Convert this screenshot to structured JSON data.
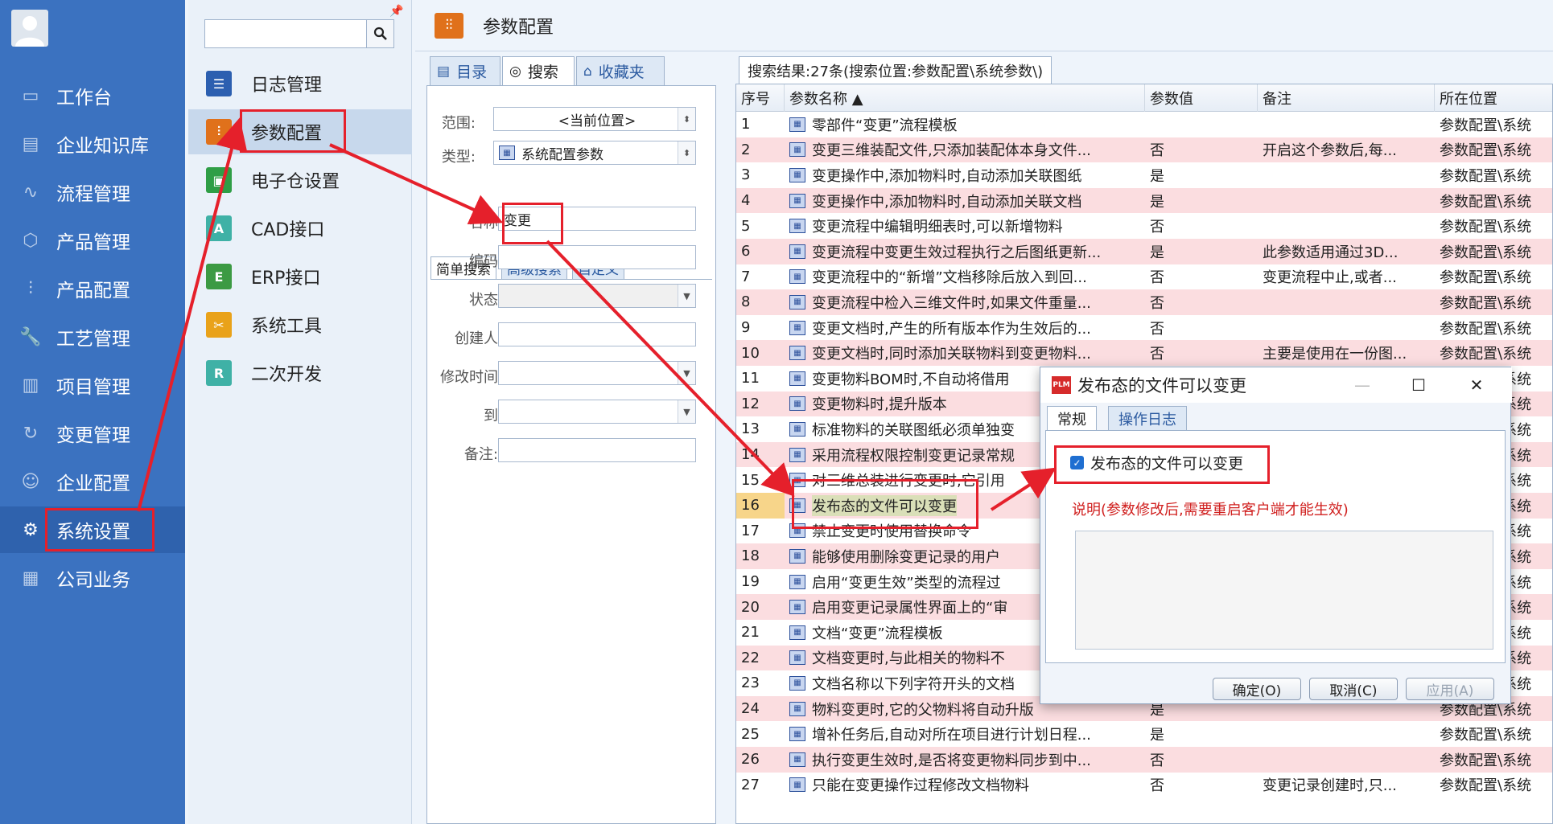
{
  "left_nav": {
    "items": [
      {
        "label": "工作台",
        "icon": "monitor-icon"
      },
      {
        "label": "企业知识库",
        "icon": "book-icon"
      },
      {
        "label": "流程管理",
        "icon": "flow-icon"
      },
      {
        "label": "产品管理",
        "icon": "cube-icon"
      },
      {
        "label": "产品配置",
        "icon": "sliders-icon"
      },
      {
        "label": "工艺管理",
        "icon": "wrench-icon"
      },
      {
        "label": "项目管理",
        "icon": "project-icon"
      },
      {
        "label": "变更管理",
        "icon": "change-icon"
      },
      {
        "label": "企业配置",
        "icon": "users-icon"
      },
      {
        "label": "系统设置",
        "icon": "gear-icon",
        "active": true
      },
      {
        "label": "公司业务",
        "icon": "grid-icon"
      }
    ]
  },
  "sub_nav": {
    "search_value": "",
    "items": [
      {
        "label": "日志管理",
        "icon": "log-icon",
        "color": "#2c5fb0"
      },
      {
        "label": "参数配置",
        "icon": "sliders-icon",
        "color": "#e0711b",
        "active": true
      },
      {
        "label": "电子仓设置",
        "icon": "warehouse-icon",
        "color": "#2f9e46"
      },
      {
        "label": "CAD接口",
        "icon": "cad-icon",
        "color": "#3fb1a6"
      },
      {
        "label": "ERP接口",
        "icon": "erp-icon",
        "color": "#3c9a43"
      },
      {
        "label": "系统工具",
        "icon": "tools-icon",
        "color": "#e9a21a"
      },
      {
        "label": "二次开发",
        "icon": "dev-icon",
        "color": "#3fb1a6"
      }
    ]
  },
  "main": {
    "title": "参数配置",
    "panel_tabs": [
      "目录",
      "搜索",
      "收藏夹"
    ],
    "scope_label": "范围:",
    "scope_value": "<当前位置>",
    "type_label": "类型:",
    "type_value": "系统配置参数",
    "search_tabs": [
      "简单搜索",
      "高级搜索",
      "自定义"
    ],
    "fields": [
      {
        "label": "名称",
        "value": "变更"
      },
      {
        "label": "编码",
        "value": ""
      },
      {
        "label": "状态",
        "value": ""
      },
      {
        "label": "创建人",
        "value": ""
      },
      {
        "label": "修改时间",
        "value": ""
      },
      {
        "label": "到",
        "value": ""
      },
      {
        "label": "备注:",
        "value": ""
      }
    ]
  },
  "results": {
    "tab_label": "搜索结果:27条(搜索位置:参数配置\\系统参数\\)",
    "columns": [
      "序号",
      "参数名称 ▲",
      "参数值",
      "备注",
      "所在位置"
    ],
    "rows": [
      {
        "no": "1",
        "name": "零部件“变更”流程模板",
        "value": "",
        "note": "",
        "loc": "参数配置\\系统"
      },
      {
        "no": "2",
        "name": "变更三维装配文件,只添加装配体本身文件...",
        "value": "否",
        "note": "开启这个参数后,每...",
        "loc": "参数配置\\系统"
      },
      {
        "no": "3",
        "name": "变更操作中,添加物料时,自动添加关联图纸",
        "value": "是",
        "note": "",
        "loc": "参数配置\\系统"
      },
      {
        "no": "4",
        "name": "变更操作中,添加物料时,自动添加关联文档",
        "value": "是",
        "note": "",
        "loc": "参数配置\\系统"
      },
      {
        "no": "5",
        "name": "变更流程中编辑明细表时,可以新增物料",
        "value": "否",
        "note": "",
        "loc": "参数配置\\系统"
      },
      {
        "no": "6",
        "name": "变更流程中变更生效过程执行之后图纸更新...",
        "value": "是",
        "note": "此参数适用通过3D...",
        "loc": "参数配置\\系统"
      },
      {
        "no": "7",
        "name": "变更流程中的“新增”文档移除后放入到回...",
        "value": "否",
        "note": "变更流程中止,或者...",
        "loc": "参数配置\\系统"
      },
      {
        "no": "8",
        "name": "变更流程中检入三维文件时,如果文件重量...",
        "value": "否",
        "note": "",
        "loc": "参数配置\\系统"
      },
      {
        "no": "9",
        "name": "变更文档时,产生的所有版本作为生效后的...",
        "value": "否",
        "note": "",
        "loc": "参数配置\\系统"
      },
      {
        "no": "10",
        "name": "变更文档时,同时添加关联物料到变更物料...",
        "value": "否",
        "note": "主要是使用在一份图...",
        "loc": "参数配置\\系统"
      },
      {
        "no": "11",
        "name": "变更物料BOM时,不自动将借用",
        "value": "",
        "note": "",
        "loc": "参数配置\\系统"
      },
      {
        "no": "12",
        "name": "变更物料时,提升版本",
        "value": "",
        "note": "",
        "loc": "参数配置\\系统"
      },
      {
        "no": "13",
        "name": "标准物料的关联图纸必须单独变",
        "value": "",
        "note": "",
        "loc": "参数配置\\系统"
      },
      {
        "no": "14",
        "name": "采用流程权限控制变更记录常规",
        "value": "",
        "note": "",
        "loc": "参数配置\\系统"
      },
      {
        "no": "15",
        "name": "对三维总装进行变更时,它引用",
        "value": "",
        "note": "",
        "loc": "参数配置\\系统"
      },
      {
        "no": "16",
        "name": "发布态的文件可以变更",
        "value": "",
        "note": "",
        "loc": "参数配置\\系统",
        "selected": true
      },
      {
        "no": "17",
        "name": "禁止变更时使用替换命令",
        "value": "",
        "note": "",
        "loc": "参数配置\\系统"
      },
      {
        "no": "18",
        "name": "能够使用删除变更记录的用户",
        "value": "",
        "note": "",
        "loc": "参数配置\\系统"
      },
      {
        "no": "19",
        "name": "启用“变更生效”类型的流程过",
        "value": "",
        "note": "",
        "loc": "参数配置\\系统"
      },
      {
        "no": "20",
        "name": "启用变更记录属性界面上的“审",
        "value": "",
        "note": "",
        "loc": "参数配置\\系统"
      },
      {
        "no": "21",
        "name": "文档“变更”流程模板",
        "value": "",
        "note": "",
        "loc": "参数配置\\系统"
      },
      {
        "no": "22",
        "name": "文档变更时,与此相关的物料不",
        "value": "",
        "note": "",
        "loc": "参数配置\\系统"
      },
      {
        "no": "23",
        "name": "文档名称以下列字符开头的文档",
        "value": "",
        "note": "",
        "loc": "参数配置\\系统"
      },
      {
        "no": "24",
        "name": "物料变更时,它的父物料将自动升版",
        "value": "是",
        "note": "",
        "loc": "参数配置\\系统"
      },
      {
        "no": "25",
        "name": "增补任务后,自动对所在项目进行计划日程...",
        "value": "是",
        "note": "",
        "loc": "参数配置\\系统"
      },
      {
        "no": "26",
        "name": "执行变更生效时,是否将变更物料同步到中...",
        "value": "否",
        "note": "",
        "loc": "参数配置\\系统"
      },
      {
        "no": "27",
        "name": "只能在变更操作过程修改文档物料",
        "value": "否",
        "note": "变更记录创建时,只...",
        "loc": "参数配置\\系统"
      }
    ]
  },
  "dialog": {
    "logo": "PLM",
    "title": "发布态的文件可以变更",
    "tabs": [
      "常规",
      "操作日志"
    ],
    "checkbox_label": "发布态的文件可以变更",
    "checked": true,
    "note": "说明(参数修改后,需要重启客户端才能生效)",
    "ok": "确定(O)",
    "cancel": "取消(C)",
    "apply": "应用(A)"
  },
  "colors": {
    "nav_bg": "#3b72c0",
    "pink_row": "#fbdde0",
    "annotation": "#e5202b"
  }
}
